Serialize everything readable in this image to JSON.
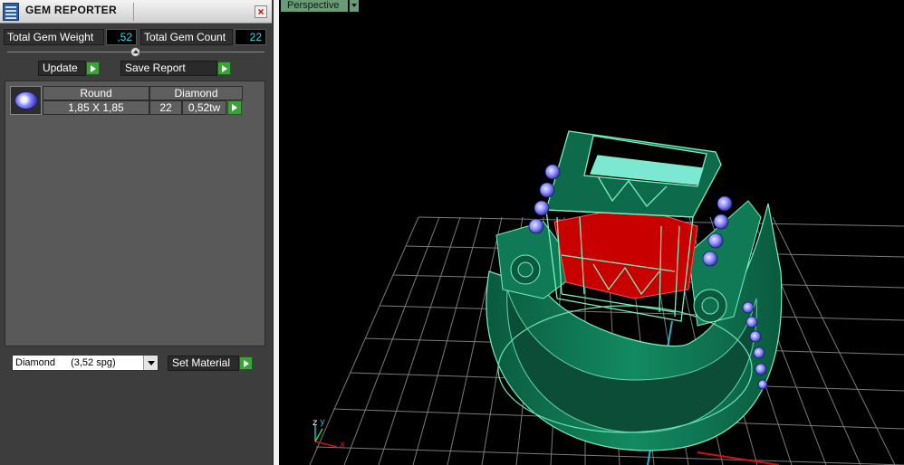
{
  "panel": {
    "title": "GEM REPORTER",
    "close_icon": "close-icon",
    "stats": {
      "weight_label": "Total Gem Weight",
      "weight_value": ",52",
      "count_label": "Total Gem Count",
      "count_value": "22"
    },
    "buttons": {
      "update": "Update",
      "save_report": "Save Report",
      "set_material": "Set Material"
    },
    "gem_table": {
      "headers": [
        "Round",
        "Diamond"
      ],
      "row": {
        "size": "1,85 X 1,85",
        "count": "22",
        "weight": "0,52tw"
      }
    },
    "material_select": {
      "value": "Diamond",
      "density": "(3,52 spg)"
    }
  },
  "viewport": {
    "label": "Perspective",
    "axes": {
      "x": "x",
      "y": "y",
      "z": "z"
    }
  },
  "colors": {
    "panel_bg": "#3d3d3d",
    "accent_cyan": "#39d6e6",
    "play_green": "#3da23a",
    "ring_green": "#0f6a4c",
    "gem_blue": "#8c8cff",
    "center_red": "#c80000"
  }
}
